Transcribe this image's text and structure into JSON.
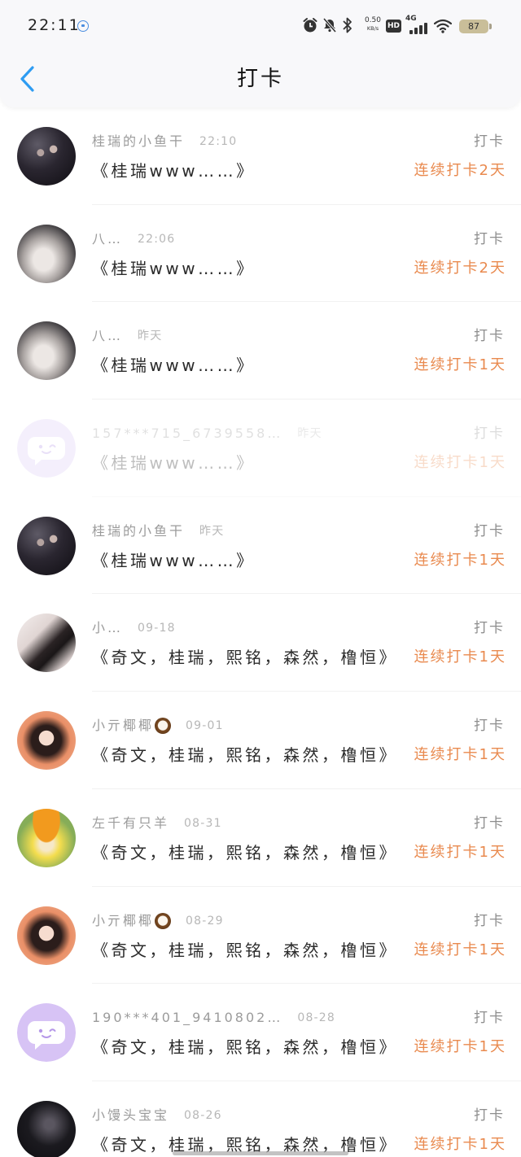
{
  "status_bar": {
    "time": "22:11",
    "net_speed": "0.50",
    "net_unit": "KB/s",
    "hd_label": "HD",
    "network_type": "4G",
    "battery_level": "87"
  },
  "header": {
    "title": "打卡",
    "back_icon": "chevron-left-icon"
  },
  "colors": {
    "accent": "#2e9cf2",
    "streak": "#e98a4f",
    "default_avatar": "#dccbf7"
  },
  "items": [
    {
      "name": "桂瑞的小鱼干",
      "time": "22:10",
      "book": "《桂瑞www……》",
      "action": "打卡",
      "streak": "连续打卡2天",
      "avatar": "user-photo"
    },
    {
      "name": "八…",
      "time": "22:06",
      "book": "《桂瑞www……》",
      "action": "打卡",
      "streak": "连续打卡2天",
      "avatar": "user-photo"
    },
    {
      "name": "八…",
      "time": "昨天",
      "book": "《桂瑞www……》",
      "action": "打卡",
      "streak": "连续打卡1天",
      "avatar": "user-photo"
    },
    {
      "name": "157***715_6739558…",
      "time": "昨天",
      "book": "《桂瑞www……》",
      "action": "打卡",
      "streak": "连续打卡1天",
      "avatar": "default-avatar-icon",
      "dimmed": true
    },
    {
      "name": "桂瑞的小鱼干",
      "time": "昨天",
      "book": "《桂瑞www……》",
      "action": "打卡",
      "streak": "连续打卡1天",
      "avatar": "user-photo"
    },
    {
      "name": "小…",
      "time": "09-18",
      "book": "《奇文，桂瑞，熙铭，森然，橹恒》",
      "action": "打卡",
      "streak": "连续打卡1天",
      "avatar": "user-photo"
    },
    {
      "name": "小亓椰椰",
      "name_icon": "coconut-icon",
      "time": "09-01",
      "book": "《奇文，桂瑞，熙铭，森然，橹恒》",
      "action": "打卡",
      "streak": "连续打卡1天",
      "avatar": "user-photo"
    },
    {
      "name": "左千有只羊",
      "time": "08-31",
      "book": "《奇文，桂瑞，熙铭，森然，橹恒》",
      "action": "打卡",
      "streak": "连续打卡1天",
      "avatar": "user-photo"
    },
    {
      "name": "小亓椰椰",
      "name_icon": "coconut-icon",
      "time": "08-29",
      "book": "《奇文，桂瑞，熙铭，森然，橹恒》",
      "action": "打卡",
      "streak": "连续打卡1天",
      "avatar": "user-photo"
    },
    {
      "name": "190***401_9410802…",
      "time": "08-28",
      "book": "《奇文，桂瑞，熙铭，森然，橹恒》",
      "action": "打卡",
      "streak": "连续打卡1天",
      "avatar": "default-avatar-icon"
    },
    {
      "name": "小馒头宝宝",
      "time": "08-26",
      "book": "《奇文，桂瑞，熙铭，森然，橹恒》",
      "action": "打卡",
      "streak": "连续打卡1天",
      "avatar": "user-photo"
    }
  ]
}
